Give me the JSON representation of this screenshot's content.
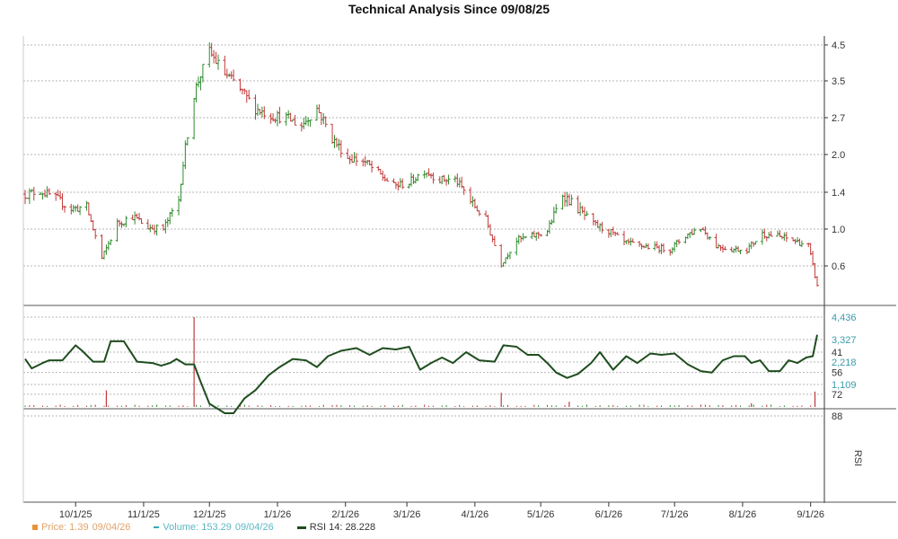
{
  "chart_data": [
    {
      "type": "ohlc",
      "panel": "price",
      "title": "Technical Analysis Since 09/08/25",
      "up_color": "#2e8b2e",
      "down_color": "#c23a3a",
      "y_ticks": [
        "4.5",
        "3.5",
        "2.7",
        "2.0",
        "1.4",
        "1.0",
        "0.6"
      ],
      "x_ticks": [
        "10/1/25",
        "11/1/25",
        "12/1/25",
        "1/1/26",
        "2/1/26",
        "3/1/26",
        "4/1/26",
        "5/1/26",
        "6/1/26",
        "7/1/26",
        "8/1/26",
        "9/1/26"
      ],
      "x_tick_dates": [
        "2025-10-01",
        "2025-11-01",
        "2025-12-01",
        "2026-01-01",
        "2026-02-01",
        "2026-03-01",
        "2026-04-01",
        "2026-05-01",
        "2026-06-01",
        "2026-07-01",
        "2026-08-01",
        "2026-09-01"
      ],
      "x_range": [
        "2025-09-08",
        "2026-09-04"
      ],
      "closes_approx": [
        [
          "2025-09-08",
          1.38
        ],
        [
          "2025-09-15",
          1.42
        ],
        [
          "2025-09-22",
          1.33
        ],
        [
          "2025-09-29",
          1.22
        ],
        [
          "2025-10-06",
          1.24
        ],
        [
          "2025-10-13",
          0.68
        ],
        [
          "2025-10-20",
          1.06
        ],
        [
          "2025-10-27",
          1.14
        ],
        [
          "2025-11-03",
          1.02
        ],
        [
          "2025-11-10",
          1.0
        ],
        [
          "2025-11-17",
          1.32
        ],
        [
          "2025-11-24",
          3.2
        ],
        [
          "2025-12-01",
          4.3
        ],
        [
          "2025-12-08",
          3.7
        ],
        [
          "2025-12-15",
          3.3
        ],
        [
          "2025-12-22",
          2.9
        ],
        [
          "2025-12-29",
          2.75
        ],
        [
          "2026-01-05",
          2.7
        ],
        [
          "2026-01-12",
          2.55
        ],
        [
          "2026-01-19",
          2.9
        ],
        [
          "2026-01-26",
          2.3
        ],
        [
          "2026-02-02",
          1.95
        ],
        [
          "2026-02-09",
          1.9
        ],
        [
          "2026-02-16",
          1.7
        ],
        [
          "2026-02-23",
          1.5
        ],
        [
          "2026-03-02",
          1.55
        ],
        [
          "2026-03-09",
          1.75
        ],
        [
          "2026-03-16",
          1.6
        ],
        [
          "2026-03-23",
          1.6
        ],
        [
          "2026-03-30",
          1.3
        ],
        [
          "2026-04-06",
          1.1
        ],
        [
          "2026-04-13",
          0.62
        ],
        [
          "2026-04-20",
          0.88
        ],
        [
          "2026-04-27",
          0.92
        ],
        [
          "2026-05-04",
          0.98
        ],
        [
          "2026-05-11",
          1.38
        ],
        [
          "2026-05-18",
          1.22
        ],
        [
          "2026-05-25",
          1.05
        ],
        [
          "2026-06-01",
          0.98
        ],
        [
          "2026-06-08",
          0.85
        ],
        [
          "2026-06-15",
          0.82
        ],
        [
          "2026-06-22",
          0.8
        ],
        [
          "2026-06-29",
          0.78
        ],
        [
          "2026-07-06",
          0.93
        ],
        [
          "2026-07-13",
          1.02
        ],
        [
          "2026-07-20",
          0.82
        ],
        [
          "2026-07-27",
          0.78
        ],
        [
          "2026-08-03",
          0.78
        ],
        [
          "2026-08-10",
          0.95
        ],
        [
          "2026-08-17",
          0.92
        ],
        [
          "2026-08-24",
          0.88
        ],
        [
          "2026-08-31",
          0.82
        ],
        [
          "2026-09-04",
          0.38
        ]
      ]
    },
    {
      "type": "bar",
      "panel": "volume",
      "color": "#c23a3a",
      "y_ticks": [
        "4,436",
        "3,327",
        "2,218",
        "1,109"
      ],
      "y_range": [
        0,
        4436
      ],
      "spikes": [
        [
          "2025-10-15",
          820
        ],
        [
          "2025-11-24",
          4436
        ],
        [
          "2026-04-13",
          700
        ],
        [
          "2026-05-14",
          260
        ],
        [
          "2026-08-05",
          180
        ],
        [
          "2026-09-03",
          760
        ]
      ],
      "baseline_level": 90
    },
    {
      "type": "line",
      "panel": "rsi",
      "color": "#1e4d1e",
      "y_label": "RSI",
      "y_ticks": [
        "88",
        "72",
        "56",
        "41"
      ],
      "y_tick_values": [
        88,
        72,
        56,
        41
      ],
      "y_range": [
        29,
        90
      ],
      "points": [
        [
          "2025-09-08",
          46
        ],
        [
          "2025-09-11",
          53
        ],
        [
          "2025-09-16",
          49
        ],
        [
          "2025-09-19",
          47
        ],
        [
          "2025-09-25",
          47
        ],
        [
          "2025-10-01",
          36
        ],
        [
          "2025-10-04",
          40
        ],
        [
          "2025-10-09",
          48
        ],
        [
          "2025-10-14",
          48
        ],
        [
          "2025-10-17",
          33
        ],
        [
          "2025-10-23",
          33
        ],
        [
          "2025-10-29",
          48
        ],
        [
          "2025-11-05",
          49
        ],
        [
          "2025-11-09",
          51
        ],
        [
          "2025-11-13",
          49
        ],
        [
          "2025-11-16",
          46
        ],
        [
          "2025-11-20",
          50
        ],
        [
          "2025-11-24",
          50
        ],
        [
          "2025-11-27",
          63
        ],
        [
          "2025-12-01",
          79
        ],
        [
          "2025-12-05",
          83
        ],
        [
          "2025-12-08",
          86
        ],
        [
          "2025-12-12",
          86
        ],
        [
          "2025-12-17",
          75
        ],
        [
          "2025-12-22",
          69
        ],
        [
          "2025-12-28",
          58
        ],
        [
          "2026-01-02",
          52
        ],
        [
          "2026-01-08",
          46
        ],
        [
          "2026-01-14",
          47
        ],
        [
          "2026-01-19",
          52
        ],
        [
          "2026-01-24",
          44
        ],
        [
          "2026-01-30",
          40
        ],
        [
          "2026-02-06",
          38
        ],
        [
          "2026-02-12",
          43
        ],
        [
          "2026-02-18",
          38
        ],
        [
          "2026-02-24",
          39
        ],
        [
          "2026-03-02",
          37
        ],
        [
          "2026-03-07",
          54
        ],
        [
          "2026-03-12",
          49
        ],
        [
          "2026-03-17",
          45
        ],
        [
          "2026-03-22",
          49
        ],
        [
          "2026-03-28",
          41
        ],
        [
          "2026-04-03",
          47
        ],
        [
          "2026-04-10",
          48
        ],
        [
          "2026-04-14",
          36
        ],
        [
          "2026-04-20",
          37
        ],
        [
          "2026-04-25",
          43
        ],
        [
          "2026-04-30",
          43
        ],
        [
          "2026-05-04",
          49
        ],
        [
          "2026-05-08",
          56
        ],
        [
          "2026-05-13",
          60
        ],
        [
          "2026-05-18",
          57
        ],
        [
          "2026-05-24",
          49
        ],
        [
          "2026-05-28",
          41
        ],
        [
          "2026-06-03",
          54
        ],
        [
          "2026-06-09",
          44
        ],
        [
          "2026-06-14",
          49
        ],
        [
          "2026-06-20",
          42
        ],
        [
          "2026-06-25",
          43
        ],
        [
          "2026-07-01",
          42
        ],
        [
          "2026-07-07",
          50
        ],
        [
          "2026-07-13",
          55
        ],
        [
          "2026-07-18",
          56
        ],
        [
          "2026-07-23",
          47
        ],
        [
          "2026-07-28",
          44
        ],
        [
          "2026-08-02",
          44
        ],
        [
          "2026-08-05",
          49
        ],
        [
          "2026-08-09",
          47
        ],
        [
          "2026-08-13",
          55
        ],
        [
          "2026-08-18",
          55
        ],
        [
          "2026-08-22",
          47
        ],
        [
          "2026-08-26",
          49
        ],
        [
          "2026-08-30",
          45
        ],
        [
          "2026-09-02",
          44
        ],
        [
          "2026-09-04",
          28.2
        ]
      ]
    }
  ],
  "legend": {
    "price": "Price: 1.39",
    "price_date": "09/04/26",
    "volume": "Volume: 153.29",
    "volume_date": "09/04/26",
    "rsi": "RSI 14: 28.228"
  }
}
